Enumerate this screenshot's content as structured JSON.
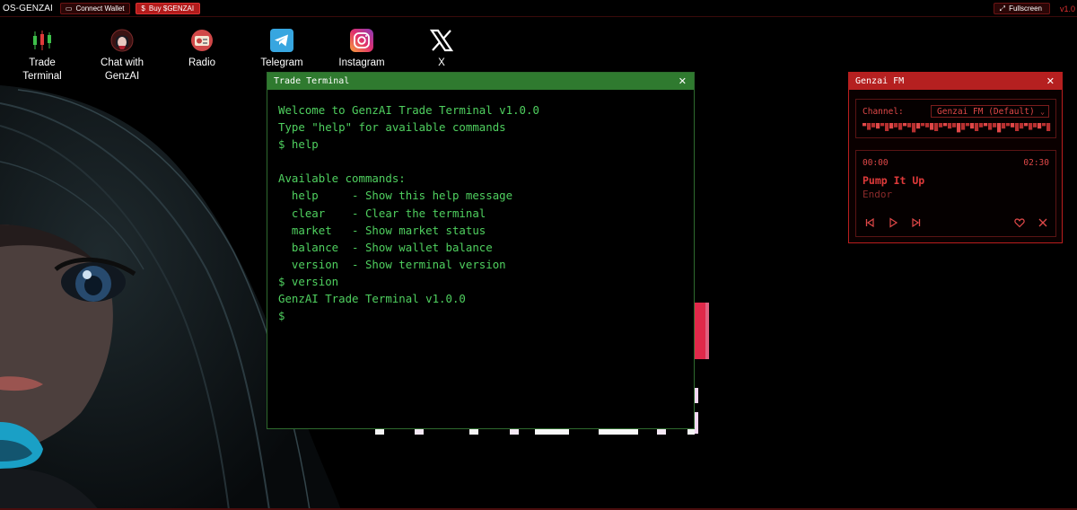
{
  "topbar": {
    "brand": "OS-GENZAI",
    "connect_wallet": "Connect Wallet",
    "buy": "Buy $GENZAI",
    "fullscreen": "Fullscreen",
    "version": "v1.0"
  },
  "desktop": [
    {
      "line1": "Trade",
      "line2": "Terminal",
      "icon": "candlestick-chart-icon"
    },
    {
      "line1": "Chat with",
      "line2": "GenzAI",
      "icon": "anime-avatar-icon"
    },
    {
      "line1": "Radio",
      "line2": "",
      "icon": "radio-icon"
    },
    {
      "line1": "Telegram",
      "line2": "",
      "icon": "telegram-icon"
    },
    {
      "line1": "Instagram",
      "line2": "",
      "icon": "instagram-icon"
    },
    {
      "line1": "X",
      "line2": "",
      "icon": "x-logo-icon"
    }
  ],
  "terminal": {
    "title": "Trade Terminal",
    "lines": [
      "Welcome to GenzAI Trade Terminal v1.0.0",
      "Type \"help\" for available commands",
      "$ help",
      "",
      "Available commands:",
      "  help     - Show this help message",
      "  clear    - Clear the terminal",
      "  market   - Show market status",
      "  balance  - Show wallet balance",
      "  version  - Show terminal version",
      "$ version",
      "GenzAI Trade Terminal v1.0.0",
      "$ "
    ]
  },
  "radio": {
    "title": "Genzai FM",
    "channel_label": "Channel:",
    "channel_value": "Genzai FM (Default)",
    "time_current": "00:00",
    "time_total": "02:30",
    "song": "Pump It Up",
    "artist": "Endor"
  },
  "colors": {
    "terminal_green": "#4fd05f",
    "terminal_title": "#2f7a2f",
    "radio_red": "#b52020",
    "accent_red": "#e03030"
  }
}
